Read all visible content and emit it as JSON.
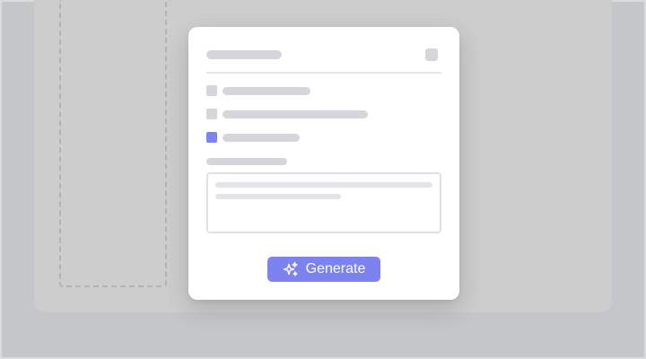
{
  "modal": {
    "options": [
      {
        "checked": false,
        "label_width_fraction": 0.37
      },
      {
        "checked": false,
        "label_width_fraction": 0.62
      },
      {
        "checked": true,
        "label_width_fraction": 0.33
      }
    ],
    "generate_button": {
      "label": "Generate",
      "icon": "sparkles-icon",
      "color": "#7c83f0"
    }
  },
  "colors": {
    "backdrop": "#c5c6c9",
    "surface": "#cdcdcd",
    "skeleton": "#d5d6dc",
    "accent": "#7c83f0"
  }
}
